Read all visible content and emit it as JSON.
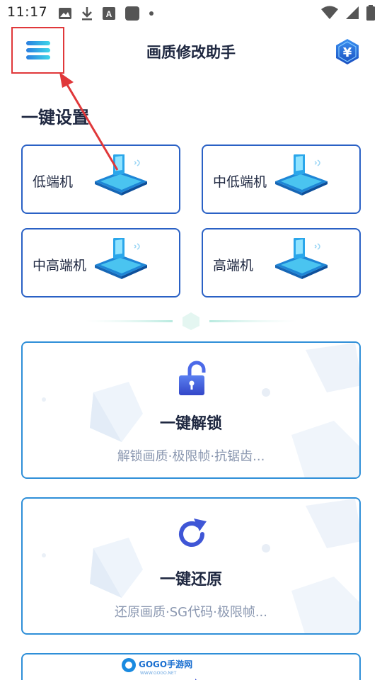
{
  "status_bar": {
    "time": "11:17",
    "icons_left": [
      "image-icon",
      "download-icon",
      "font-a-icon",
      "square-icon",
      "dot-icon"
    ],
    "icons_right": [
      "wifi-icon",
      "signal-icon",
      "battery-icon"
    ]
  },
  "header": {
    "title": "画质修改助手",
    "menu_icon": "hamburger-menu-icon",
    "coin_icon": "yuan-coin-icon",
    "coin_symbol": "¥"
  },
  "one_click_settings": {
    "title": "一键设置",
    "tiers": [
      {
        "label": "低端机"
      },
      {
        "label": "中低端机"
      },
      {
        "label": "中高端机"
      },
      {
        "label": "高端机"
      }
    ]
  },
  "actions": [
    {
      "title": "一键解锁",
      "subtitle": "解锁画质·极限帧·抗锯齿...",
      "icon": "unlock-icon"
    },
    {
      "title": "一键还原",
      "subtitle": "还原画质·SG代码·极限帧...",
      "icon": "refresh-icon"
    }
  ],
  "watermark": {
    "text": "GOGO手游网",
    "subtext": "WWW.GOGO.NET"
  },
  "colors": {
    "accent_blue": "#2a61c5",
    "card_border": "#2f8fd8",
    "menu_gradient": "#3fd6e8",
    "annotation_red": "#e0383a",
    "title_dark": "#1e2740",
    "subtitle_gray": "#8a97b0"
  }
}
